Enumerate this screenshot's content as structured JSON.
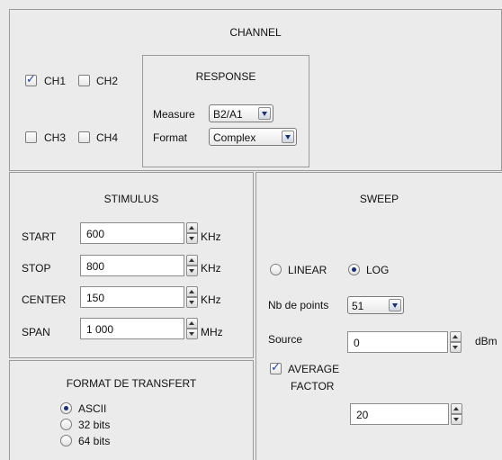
{
  "channel": {
    "title": "CHANNEL",
    "ch1": {
      "label": "CH1",
      "checked": true
    },
    "ch2": {
      "label": "CH2",
      "checked": false
    },
    "ch3": {
      "label": "CH3",
      "checked": false
    },
    "ch4": {
      "label": "CH4",
      "checked": false
    },
    "response": {
      "title": "RESPONSE",
      "measure_label": "Measure",
      "measure_value": "B2/A1",
      "format_label": "Format",
      "format_value": "Complex"
    }
  },
  "stimulus": {
    "title": "STIMULUS",
    "rows": [
      {
        "label": "START",
        "value": "600",
        "unit": "KHz"
      },
      {
        "label": "STOP",
        "value": "800",
        "unit": "KHz"
      },
      {
        "label": "CENTER",
        "value": "150",
        "unit": "KHz"
      },
      {
        "label": "SPAN",
        "value": "1 000",
        "unit": "MHz"
      }
    ]
  },
  "sweep": {
    "title": "SWEEP",
    "linear_label": "LINEAR",
    "log_label": "LOG",
    "selected": "log",
    "nb_points_label": "Nb de points",
    "nb_points_value": "51",
    "source_label": "Source",
    "source_value": "0",
    "source_unit": "dBm",
    "average_label_line1": "AVERAGE",
    "average_label_line2": "FACTOR",
    "average_checked": true,
    "average_value": "20"
  },
  "transfert": {
    "title": "FORMAT DE TRANSFERT",
    "options": [
      "ASCII",
      "32 bits",
      "64 bits"
    ],
    "selected_index": 0
  }
}
